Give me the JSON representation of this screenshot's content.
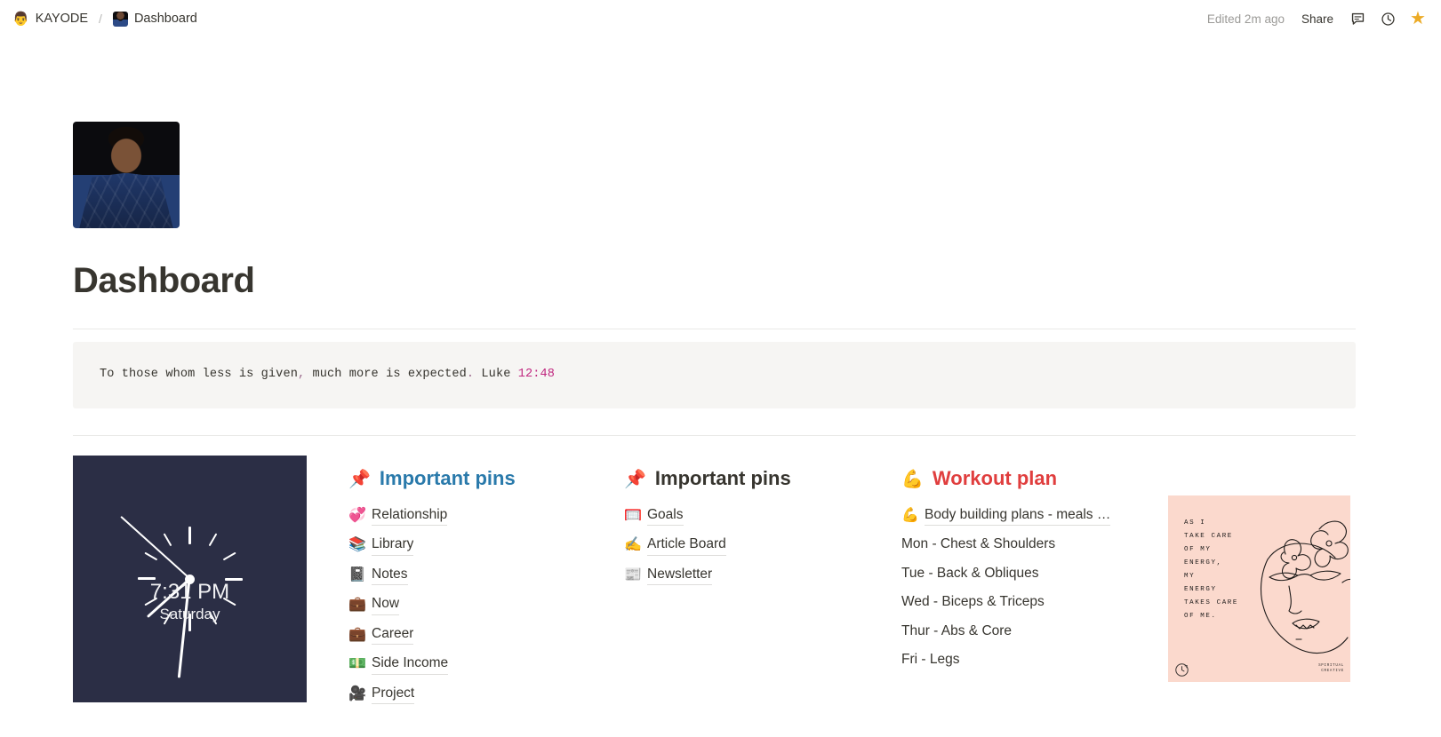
{
  "topbar": {
    "workspace_icon": "person-icon",
    "workspace": "KAYODE",
    "separator": "/",
    "page_icon": "page-photo-icon",
    "page": "Dashboard",
    "edited": "Edited 2m ago",
    "share": "Share",
    "comment_icon": "comment-icon",
    "history_icon": "clock-history-icon",
    "favorite_icon": "star-icon",
    "favorite_color": "#ecab26"
  },
  "page": {
    "icon": "profile-photo",
    "title": "Dashboard",
    "quote": {
      "text_before": "To those whom less is given",
      "comma": ",",
      "text_middle": " much more is expected",
      "period": ".",
      "reference_label": " Luke ",
      "verse": "12:48",
      "verse_color": "#c0277f",
      "background": "#f6f5f3"
    }
  },
  "clock": {
    "name": "analog-clock-widget",
    "time": "7:31 PM",
    "day": "Saturday",
    "background": "#2b2e45",
    "hand_color": "#ffffff"
  },
  "columns": {
    "pins_left": {
      "icon": "pushpin-icon",
      "title": "Important pins",
      "title_color": "#2a7aab",
      "items": [
        {
          "icon": "revolving-hearts-icon",
          "glyph": "💞",
          "label": "Relationship"
        },
        {
          "icon": "books-icon",
          "glyph": "📚",
          "label": "Library"
        },
        {
          "icon": "notebook-icon",
          "glyph": "📓",
          "label": "Notes"
        },
        {
          "icon": "briefcase-icon",
          "glyph": "💼",
          "label": "Now"
        },
        {
          "icon": "briefcase-icon",
          "glyph": "💼",
          "label": "Career"
        },
        {
          "icon": "money-icon",
          "glyph": "💵",
          "label": "Side Income"
        },
        {
          "icon": "movie-camera-icon",
          "glyph": "🎥",
          "label": "Project"
        }
      ]
    },
    "pins_right": {
      "icon": "pushpin-icon",
      "title": "Important pins",
      "title_color": "#37352f",
      "items": [
        {
          "icon": "goal-net-icon",
          "glyph": "🥅",
          "label": "Goals"
        },
        {
          "icon": "writing-hand-icon",
          "glyph": "✍️",
          "label": "Article Board"
        },
        {
          "icon": "newspaper-icon",
          "glyph": "📰",
          "label": "Newsletter"
        }
      ]
    },
    "workout": {
      "icon": "flexed-biceps-icon",
      "title": "Workout plan",
      "title_color": "#e03e3e",
      "link": {
        "icon": "flexed-biceps-icon",
        "glyph": "💪",
        "label": "Body building plans - meals …"
      },
      "days": [
        "Mon - Chest & Shoulders",
        "Tue - Back & Obliques",
        "Wed - Biceps & Triceps",
        "Thur - Abs & Core",
        "Fri - Legs"
      ]
    },
    "illustration": {
      "name": "line-art-quote-image",
      "background": "#fbd9cd",
      "quote": "AS  I\nTAKE CARE\nOF MY\nENERGY,\nMY\nENERGY\nTAKES CARE\n OF ME.",
      "signature": "SPIRITUAL\nCREATIVE",
      "badge_icon": "refresh-icon"
    }
  }
}
